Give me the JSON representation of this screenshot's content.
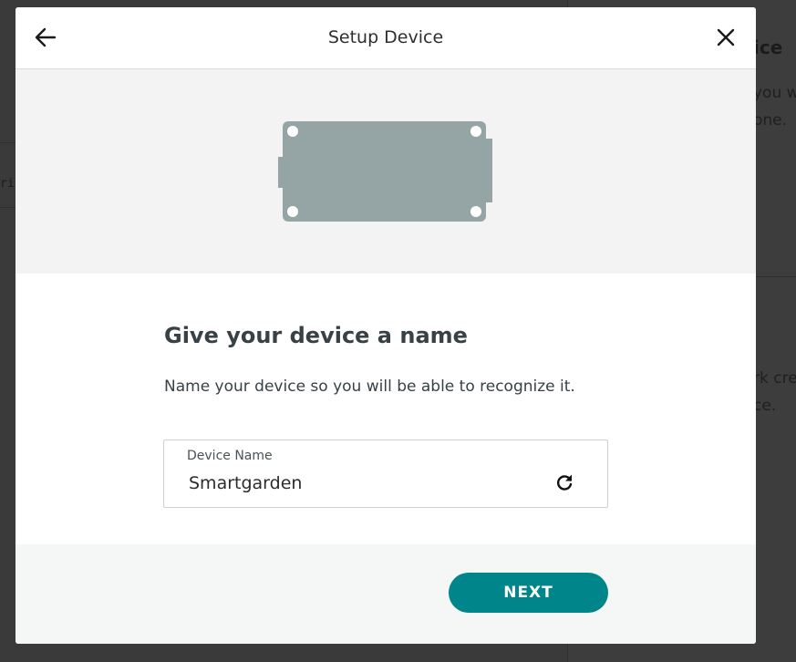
{
  "background": {
    "right_heading": "ice",
    "right_lines": [
      "you w",
      "one.",
      "rk cre",
      "ce."
    ],
    "left_code": "ri"
  },
  "modal": {
    "title": "Setup Device",
    "back_icon": "arrow-left-icon",
    "close_icon": "close-icon",
    "heading": "Give your device a name",
    "description": "Name your device so you will be able to recognize it.",
    "field": {
      "label": "Device Name",
      "value": "Smartgarden",
      "action_icon": "refresh-icon"
    },
    "next_label": "NEXT"
  },
  "colors": {
    "accent": "#00868a",
    "board": "#95a5a6",
    "illustration_bg": "#f3f3f3",
    "footer_bg": "#f5f7f6",
    "backdrop": "#3a3a3a"
  }
}
